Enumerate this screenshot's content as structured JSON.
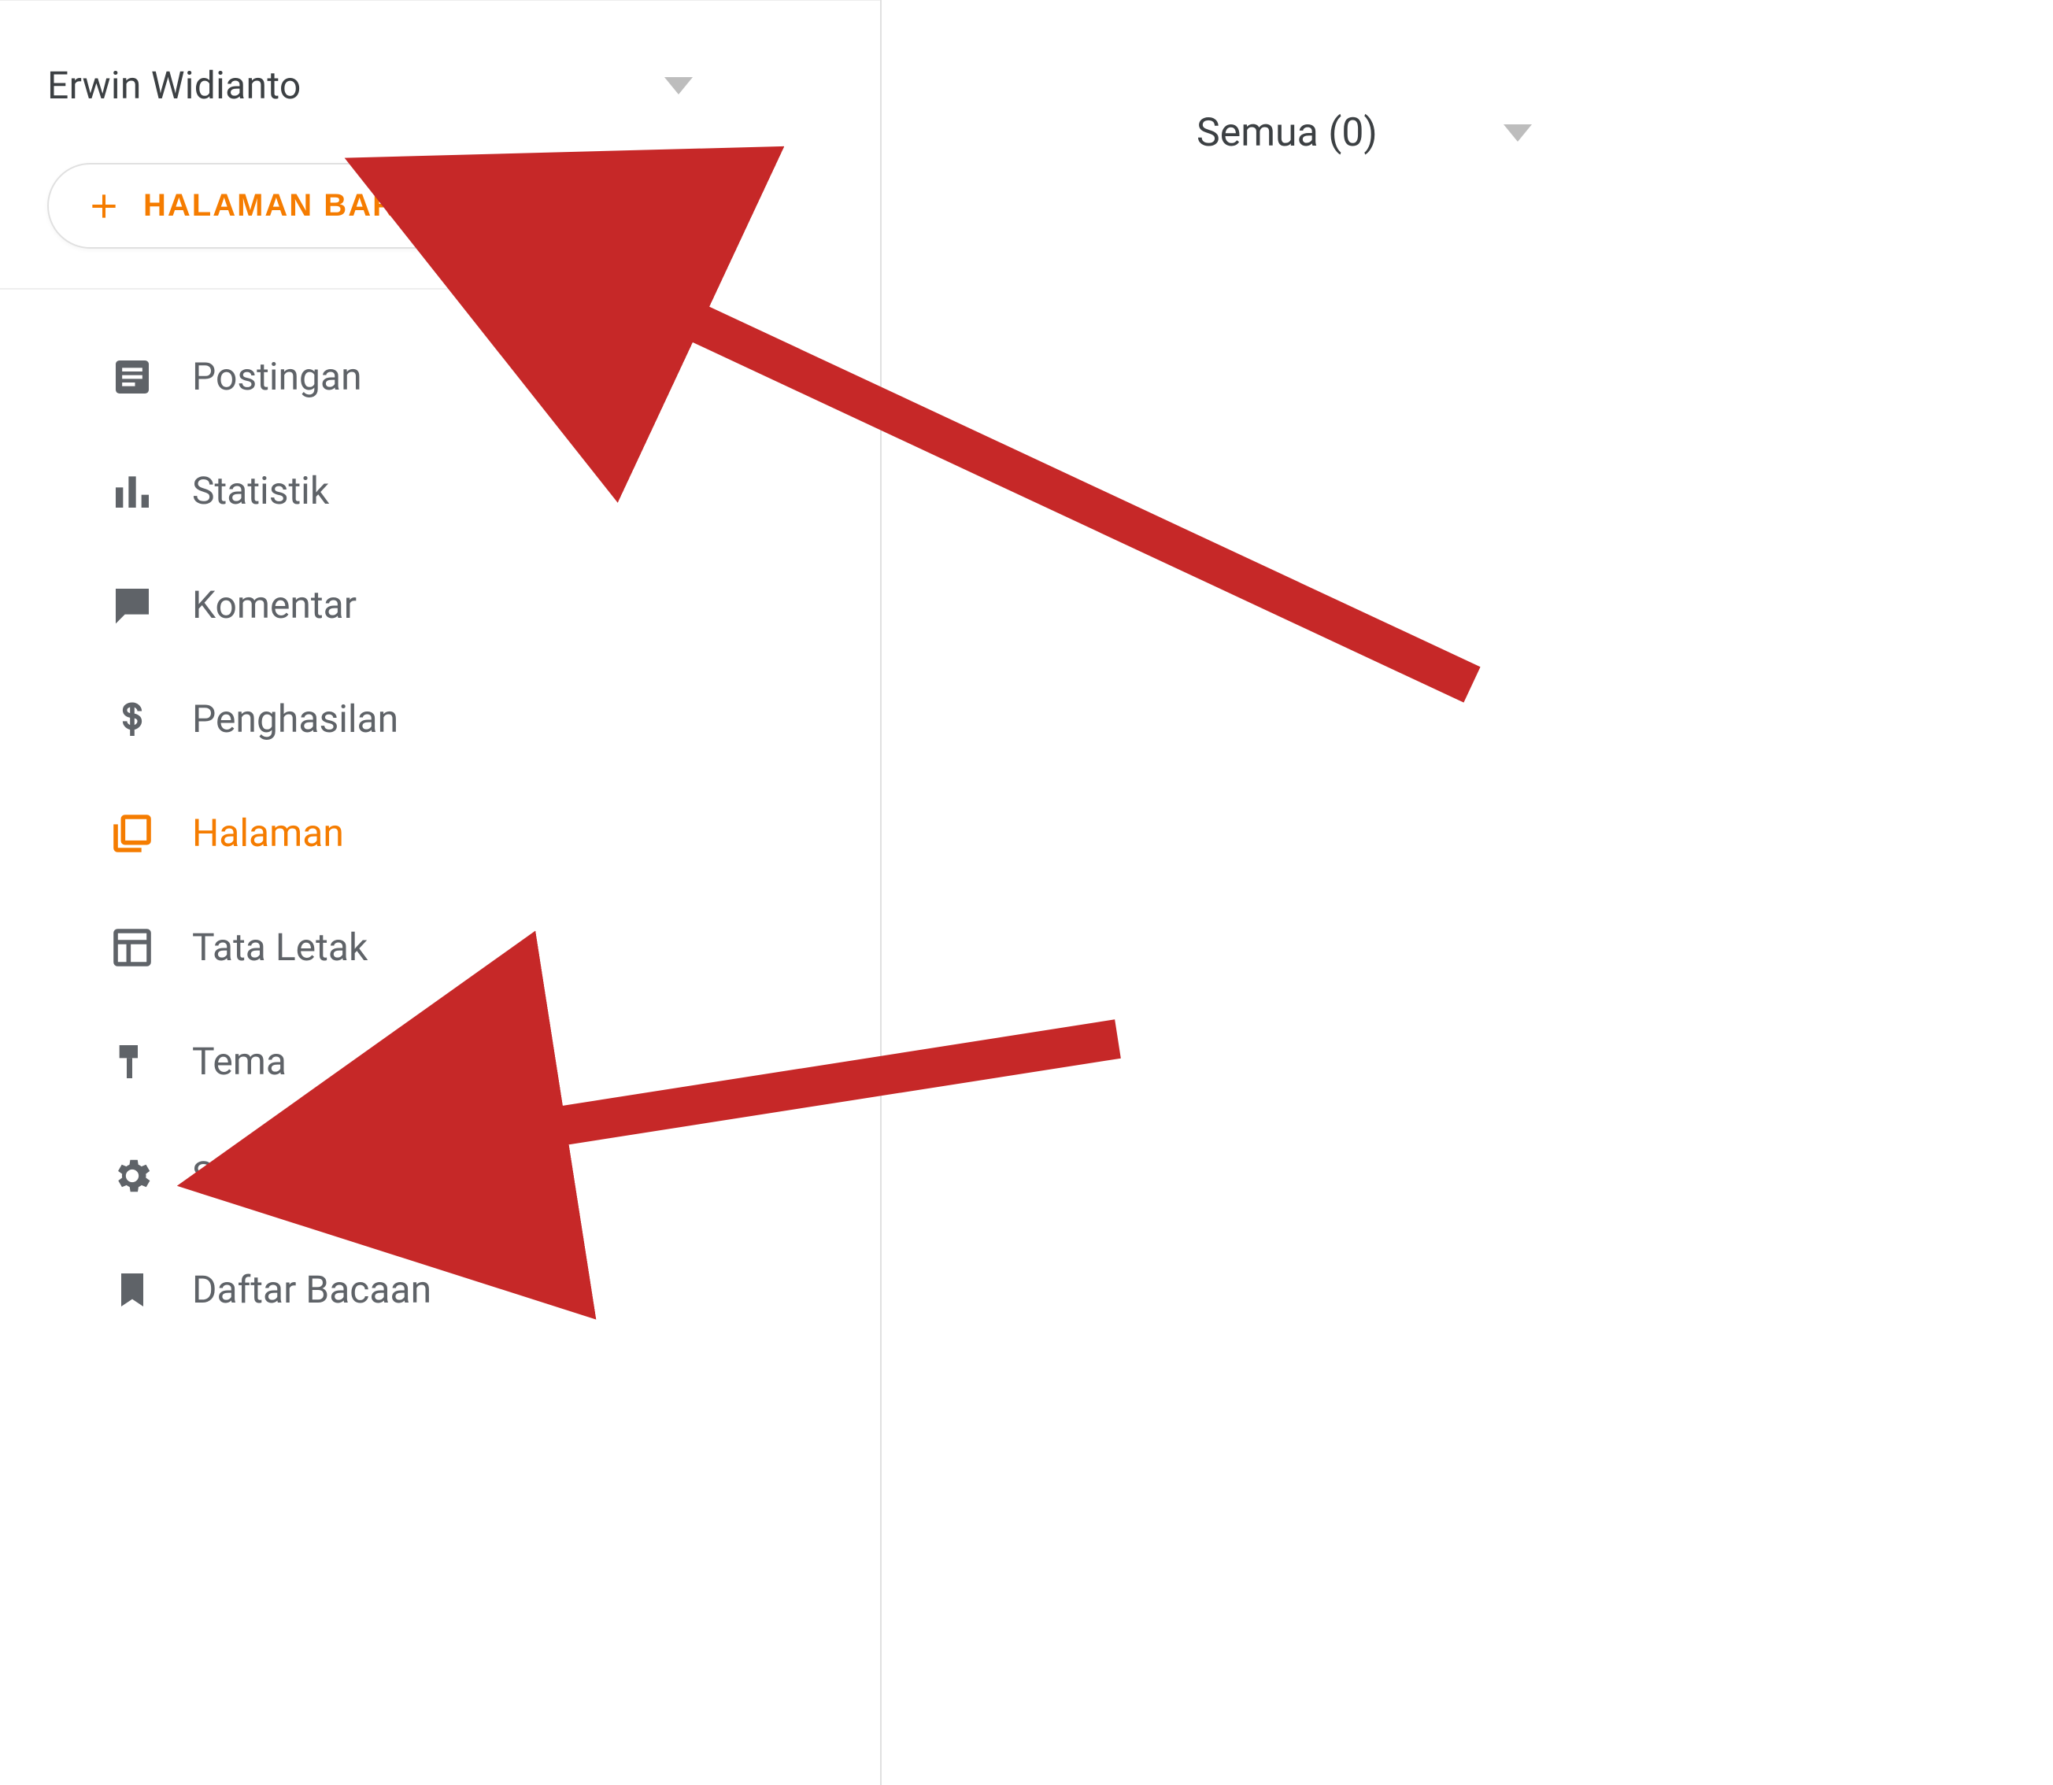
{
  "blog": {
    "name": "Erwin Widianto"
  },
  "new_page_button": {
    "label": "HALAMAN BARU"
  },
  "sidebar": {
    "items": [
      {
        "label": "Postingan"
      },
      {
        "label": "Statistik"
      },
      {
        "label": "Komentar"
      },
      {
        "label": "Penghasilan"
      },
      {
        "label": "Halaman"
      },
      {
        "label": "Tata Letak"
      },
      {
        "label": "Tema"
      },
      {
        "label": "Setelan"
      },
      {
        "label": "Daftar Bacaan"
      }
    ]
  },
  "filter": {
    "label": "Semua (0)"
  },
  "colors": {
    "accent": "#f57c00",
    "icon": "#5f6368",
    "annotation": "#c62828"
  }
}
